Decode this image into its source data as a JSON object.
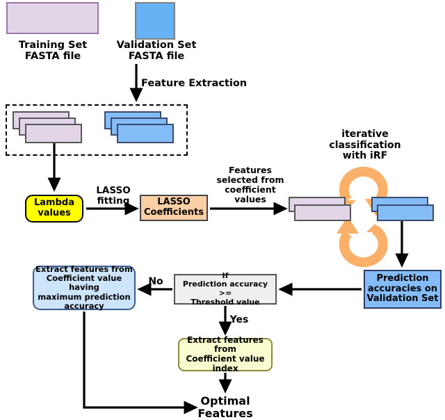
{
  "diagram": {
    "title": "Feature selection pipeline with LASSO and iterative Random Forest",
    "type": "flowchart",
    "colors": {
      "training_fill": "#E2D5E8",
      "training_border": "#9B76AE",
      "validation_fill": "#66B2F5",
      "validation_border": "#808080",
      "lambda_fill": "#FFFF00",
      "lasso_fill": "#FBCFA5",
      "prediction_fill": "#83BCF7",
      "decision_fill": "#EFEFEF",
      "extract_max_fill": "#CCE5FA",
      "extract_index_fill": "#FBFBD0",
      "loop_arrow": "#FBB069",
      "edge": "#000000"
    }
  },
  "nodes": {
    "training_set": {
      "label": "Training Set\nFASTA file",
      "shape": "rectangle"
    },
    "validation_set": {
      "label": "Validation Set\nFASTA file",
      "shape": "rectangle"
    },
    "lambda_values": {
      "label": "Lambda\nvalues",
      "shape": "rounded-rectangle"
    },
    "lasso_coefficients": {
      "label": "LASSO\nCoefficients",
      "shape": "rectangle"
    },
    "prediction_accuracies": {
      "label": "Prediction\naccuracies on\nValidation Set",
      "shape": "rectangle"
    },
    "decision": {
      "label": "If\nPrediction accuracy >=\nThreshold value",
      "shape": "rectangle"
    },
    "extract_max": {
      "label": "Extract features from\nCoefficient value having\nmaximum prediction\naccuracy",
      "shape": "rounded-rectangle"
    },
    "extract_index": {
      "label": "Extract features from\nCoefficient value\nindex",
      "shape": "rounded-rectangle"
    },
    "optimal_features": {
      "label": "Optimal\nFeatures",
      "shape": "text"
    }
  },
  "edge_labels": {
    "feature_extraction": "Feature Extraction",
    "lasso_fitting": "LASSO\nfitting",
    "features_selected": "Features\nselected from\ncoefficient\nvalues",
    "iterative_classification": "iterative\nclassification\nwith iRF",
    "no": "No",
    "yes": "Yes"
  },
  "groups": {
    "extracted_features": {
      "label": "",
      "style": "dashed-border",
      "train_stack_count": 3,
      "validation_stack_count": 3
    },
    "irf_input": {
      "train_stack_count": 2,
      "validation_stack_count": 2
    }
  }
}
